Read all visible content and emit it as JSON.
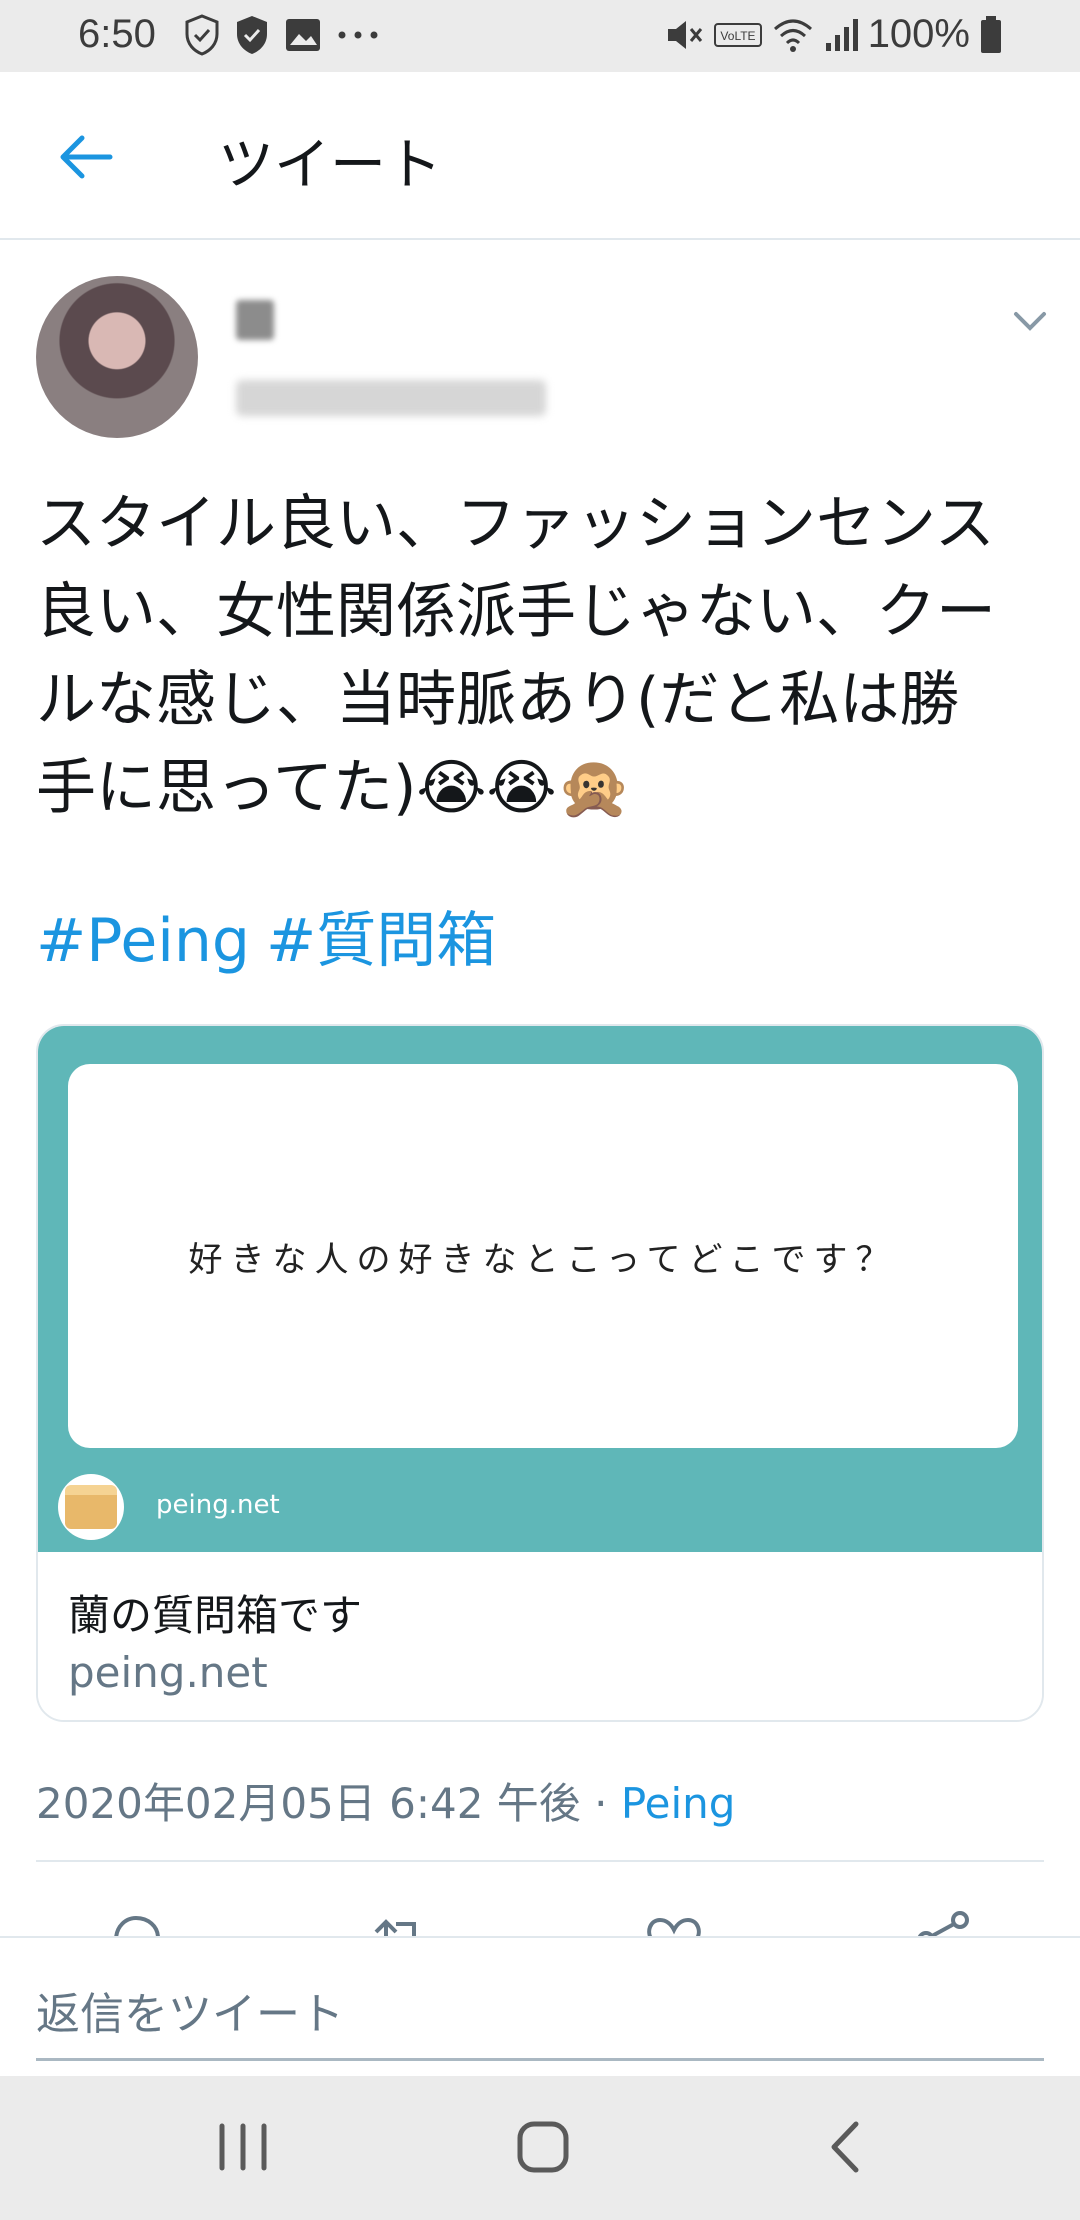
{
  "status_bar": {
    "time": "6:50",
    "battery": "100%",
    "left_icons": [
      "shield-check-icon",
      "shield-icon",
      "image-icon",
      "more-dots-icon"
    ],
    "right_icons": [
      "mute-icon",
      "volte-icon",
      "wifi-icon",
      "signal-icon",
      "battery-icon"
    ],
    "volte_label": "VoLTE"
  },
  "header": {
    "title": "ツイート"
  },
  "tweet": {
    "text": "スタイル良い、ファッションセンス\n良い、女性関係派手じゃない、クー\nルな感じ、当時脈あり(だと私は勝\n手に思ってた)😭😭🙊",
    "hashtags": [
      "#Peing",
      "#質問箱"
    ],
    "card": {
      "question": "好きな人の好きなとこってどこです？",
      "site_small": "peing.net",
      "title": "蘭の質問箱です",
      "domain": "peing.net"
    },
    "timestamp": "2020年02月05日 6:42 午後 · ",
    "source": "Peing"
  },
  "reply": {
    "placeholder": "返信をツイート"
  },
  "colors": {
    "accent": "#1b95e0",
    "card_teal": "#5fb7b8",
    "secondary_text": "#657786"
  }
}
